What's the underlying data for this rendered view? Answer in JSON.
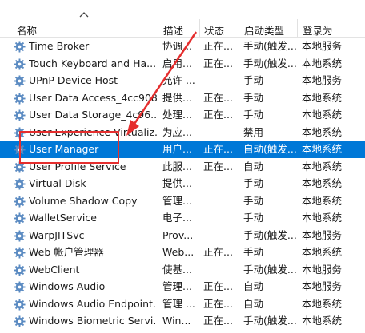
{
  "columns": {
    "name": "名称",
    "desc": "描述",
    "status": "状态",
    "startup": "启动类型",
    "logon": "登录为"
  },
  "icons": {
    "service": "gear-icon",
    "sort": "sort-up-icon"
  },
  "colors": {
    "selected": "#0078d7",
    "highlight": "#e52e2e",
    "gear": "#5b8bc2"
  },
  "services": [
    {
      "name": "Time Broker",
      "desc": "协调...",
      "status": "正在...",
      "startup": "手动(触发...",
      "logon": "本地服务"
    },
    {
      "name": "Touch Keyboard and Ha...",
      "desc": "启用...",
      "status": "正在...",
      "startup": "手动(触发...",
      "logon": "本地系统"
    },
    {
      "name": "UPnP Device Host",
      "desc": "允许 ...",
      "status": "",
      "startup": "手动",
      "logon": "本地服务"
    },
    {
      "name": "User Data Access_4cc9089",
      "desc": "提供...",
      "status": "正在...",
      "startup": "手动",
      "logon": "本地系统"
    },
    {
      "name": "User Data Storage_4c96...",
      "desc": "处理...",
      "status": "正在...",
      "startup": "手动",
      "logon": "本地系统"
    },
    {
      "name": "User Experience Virtualiz...",
      "desc": "为应...",
      "status": "",
      "startup": "禁用",
      "logon": "本地系统"
    },
    {
      "name": "User Manager",
      "desc": "用户...",
      "status": "正在...",
      "startup": "自动(触发...",
      "logon": "本地系统"
    },
    {
      "name": "User Profile Service",
      "desc": "此服...",
      "status": "正在...",
      "startup": "自动",
      "logon": "本地系统"
    },
    {
      "name": "Virtual Disk",
      "desc": "提供...",
      "status": "",
      "startup": "手动",
      "logon": "本地系统"
    },
    {
      "name": "Volume Shadow Copy",
      "desc": "管理...",
      "status": "",
      "startup": "手动",
      "logon": "本地系统"
    },
    {
      "name": "WalletService",
      "desc": "电子...",
      "status": "",
      "startup": "手动",
      "logon": "本地系统"
    },
    {
      "name": "WarpJITSvc",
      "desc": "Prov...",
      "status": "",
      "startup": "手动(触发...",
      "logon": "本地服务"
    },
    {
      "name": "Web 帐户管理器",
      "desc": "Web...",
      "status": "正在...",
      "startup": "手动",
      "logon": "本地系统"
    },
    {
      "name": "WebClient",
      "desc": "使基...",
      "status": "",
      "startup": "手动(触发...",
      "logon": "本地服务"
    },
    {
      "name": "Windows Audio",
      "desc": "管理...",
      "status": "正在...",
      "startup": "自动",
      "logon": "本地服务"
    },
    {
      "name": "Windows Audio Endpoint...",
      "desc": "管理 ...",
      "status": "正在...",
      "startup": "自动",
      "logon": "本地系统"
    },
    {
      "name": "Windows Biometric Servi...",
      "desc": "Win...",
      "status": "正在...",
      "startup": "手动(触发...",
      "logon": "本地系统"
    }
  ]
}
